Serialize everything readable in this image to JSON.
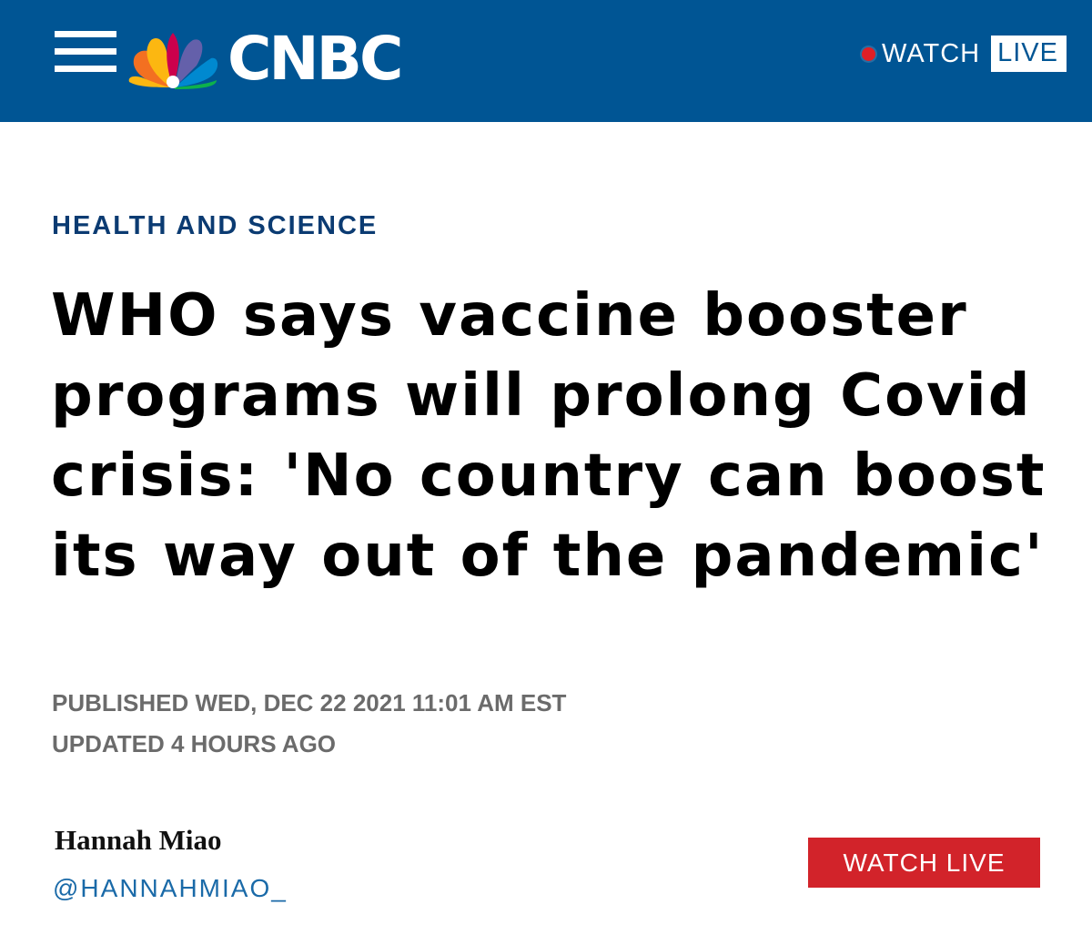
{
  "header": {
    "brand": "CNBC",
    "watch_label": "WATCH",
    "live_label": "LIVE",
    "colors": {
      "bar": "#005594",
      "live_dot": "#e01f26"
    },
    "icons": {
      "menu": "hamburger-menu-icon",
      "logo": "nbc-peacock-icon",
      "live_indicator": "red-dot-icon"
    }
  },
  "article": {
    "category": "HEALTH AND SCIENCE",
    "headline": "WHO says vaccine booster programs will prolong Covid crisis: 'No country can boost its way out of the pandemic'",
    "published": "PUBLISHED WED, DEC 22 2021 11:01 AM EST",
    "updated": "UPDATED 4 HOURS AGO",
    "author": {
      "name": "Hannah Miao",
      "handle": "@HANNAHMIAO_"
    },
    "watch_live_button": "WATCH LIVE",
    "colors": {
      "category": "#0b3b72",
      "meta": "#6b6b6b",
      "handle": "#1a6aa8",
      "button": "#d2232a"
    }
  }
}
